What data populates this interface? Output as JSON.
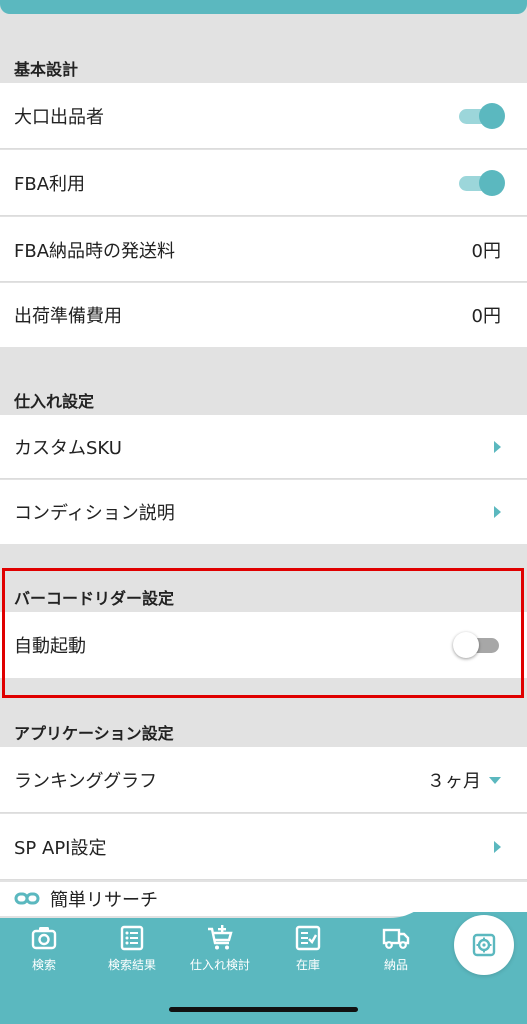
{
  "sections": {
    "basic": {
      "title": "基本設計",
      "items": [
        {
          "label": "大口出品者",
          "toggle": true
        },
        {
          "label": "FBA利用",
          "toggle": true
        },
        {
          "label": "FBA納品時の発送料",
          "value": "0円"
        },
        {
          "label": "出荷準備費用",
          "value": "0円"
        }
      ]
    },
    "purchase": {
      "title": "仕入れ設定",
      "items": [
        {
          "label": "カスタムSKU"
        },
        {
          "label": "コンディション説明"
        }
      ]
    },
    "barcode": {
      "title": "バーコードリダー設定",
      "items": [
        {
          "label": "自動起動",
          "toggle": false
        }
      ]
    },
    "app": {
      "title": "アプリケーション設定",
      "items": [
        {
          "label": "ランキンググラフ",
          "value": "３ヶ月"
        },
        {
          "label": "SP API設定"
        },
        {
          "label": "簡単リサーチ"
        }
      ]
    }
  },
  "nav": {
    "items": [
      {
        "label": "検索",
        "icon": "camera-icon"
      },
      {
        "label": "検索結果",
        "icon": "list-icon"
      },
      {
        "label": "仕入れ検討",
        "icon": "cart-add-icon"
      },
      {
        "label": "在庫",
        "icon": "inventory-check-icon"
      },
      {
        "label": "納品",
        "icon": "truck-icon"
      }
    ],
    "fab_icon": "settings-icon"
  },
  "colors": {
    "accent": "#5bb8bf",
    "highlight": "#e00000",
    "background": "#e2e2e2"
  }
}
